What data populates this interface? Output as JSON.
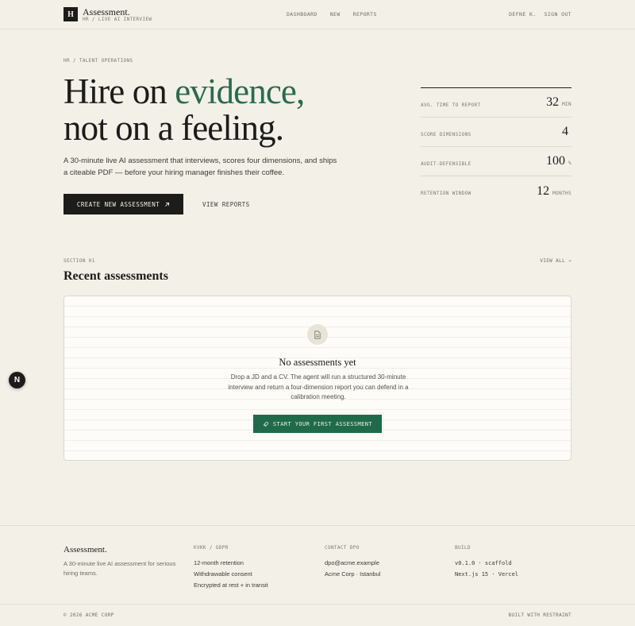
{
  "header": {
    "logo_glyph": "H",
    "brand": "Assessment.",
    "tagline": "HR / LIVE AI INTERVIEW",
    "nav": [
      "DASHBOARD",
      "NEW",
      "REPORTS"
    ],
    "user": "DEFNE K.",
    "sign_out": "SIGN OUT"
  },
  "hero": {
    "breadcrumb": "HR / TALENT OPERATIONS",
    "title_line1_a": "Hire on ",
    "title_line1_accent": "evidence,",
    "title_line2": "not on a feeling.",
    "description": "A 30-minute live AI assessment that interviews, scores four dimensions, and ships a citeable PDF — before your hiring manager finishes their coffee.",
    "primary_button": "CREATE NEW ASSESSMENT",
    "secondary_button": "VIEW REPORTS"
  },
  "stats": [
    {
      "label": "AVG. TIME TO REPORT",
      "value": "32",
      "unit": "MIN"
    },
    {
      "label": "SCORE DIMENSIONS",
      "value": "4",
      "unit": ""
    },
    {
      "label": "AUDIT-DEFENSIBLE",
      "value": "100",
      "unit": "%"
    },
    {
      "label": "RETENTION WINDOW",
      "value": "12",
      "unit": "MONTHS"
    }
  ],
  "section": {
    "label": "SECTION 01",
    "view_all": "VIEW ALL →",
    "title": "Recent assessments"
  },
  "empty_state": {
    "title": "No assessments yet",
    "description": "Drop a JD and a CV. The agent will run a structured 30-minute interview and return a four-dimension report you can defend in a calibration meeting.",
    "button": "START YOUR FIRST ASSESSMENT"
  },
  "nextjs_badge": "N",
  "footer": {
    "brand": "Assessment.",
    "tagline": "A 30-minute live AI assessment for serious hiring teams.",
    "col1": {
      "heading": "KVKK / GDPR",
      "items": [
        "12-month retention",
        "Withdrawable consent",
        "Encrypted at rest + in transit"
      ]
    },
    "col2": {
      "heading": "CONTACT DPO",
      "items": [
        "dpo@acme.example",
        "Acme Corp · Istanbul"
      ]
    },
    "col3": {
      "heading": "BUILD",
      "items": [
        "v0.1.0 · scaffold",
        "Next.js 15 · Vercel"
      ]
    },
    "copyright": "© 2026 ACME CORP",
    "built": "BUILT WITH RESTRAINT"
  },
  "colors": {
    "accent": "#2a6b4e",
    "button_green": "#1f6b49",
    "background": "#f3f0e8",
    "ink": "#1c1c1a"
  }
}
